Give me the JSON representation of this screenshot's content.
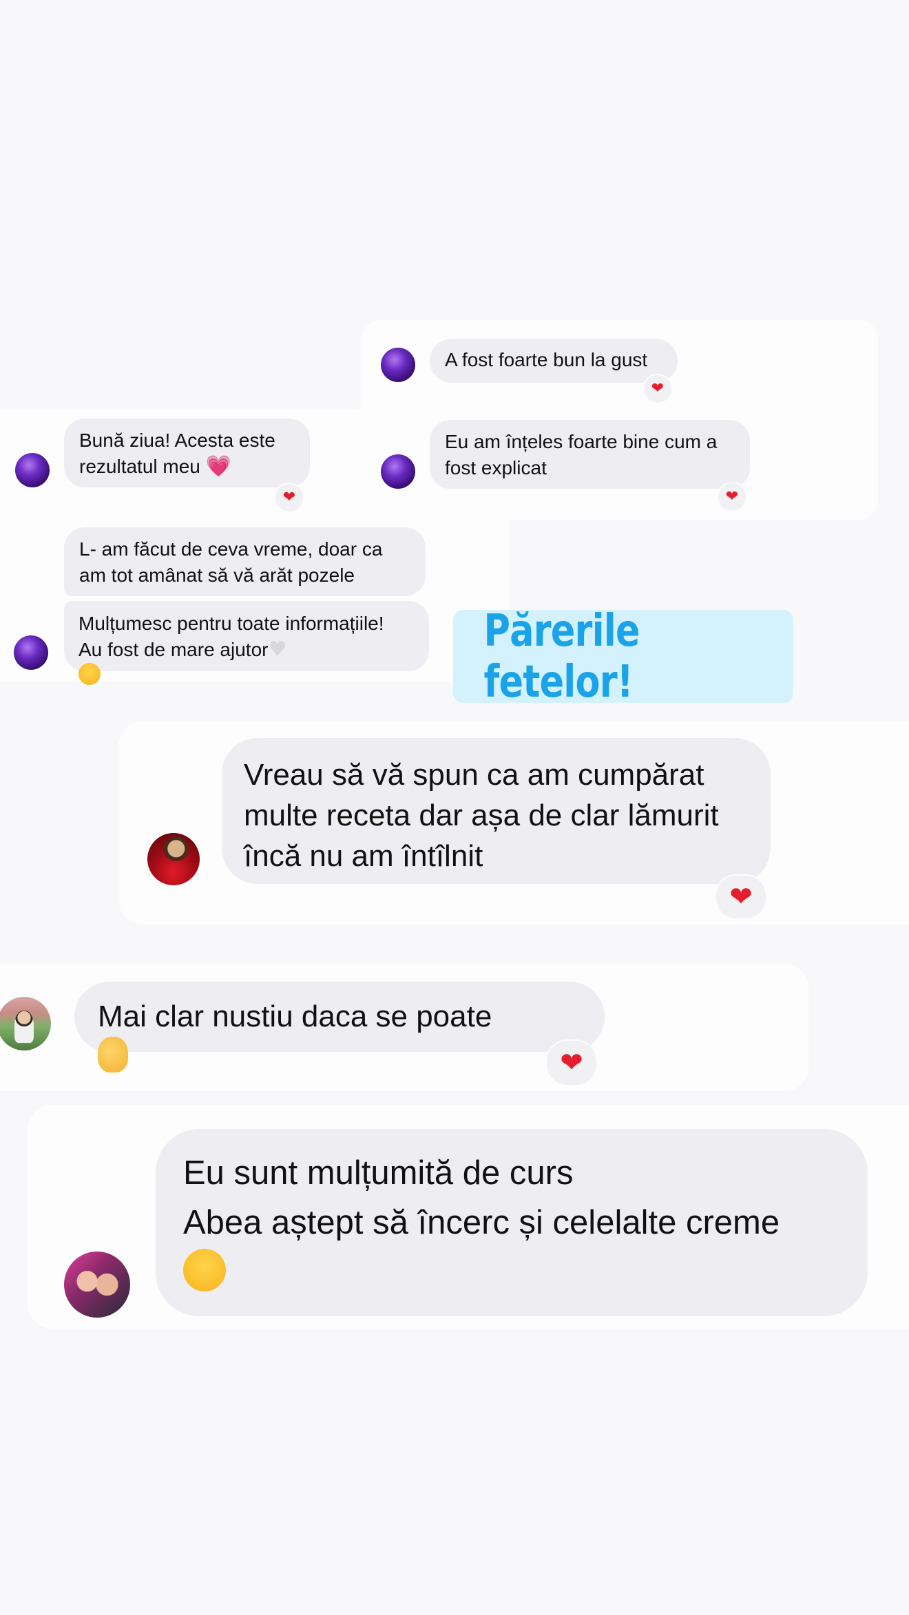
{
  "title": "Părerile fetelor!",
  "colors": {
    "background": "#f8f8fa",
    "bubble": "#eeeef2",
    "title_box": "#d3f2fd",
    "title_text": "#1aa3e8",
    "heart": "#e41e2c"
  },
  "screenshot_left": {
    "messages": [
      {
        "text": "Bună ziua! Acesta este\nrezultatul meu",
        "emoji": "pink-heart",
        "reaction": "❤"
      },
      {
        "text": "L- am făcut de ceva vreme, doar ca\nam tot amânat să vă arăt pozele"
      },
      {
        "text": "Mulțumesc pentru toate informațiile!\nAu fost de mare ajutor",
        "emoji": [
          "white-heart",
          "hugging-face"
        ]
      }
    ]
  },
  "screenshot_right": {
    "messages": [
      {
        "text": "A fost foarte bun la gust",
        "reaction": "❤"
      },
      {
        "text": "Eu am înțeles foarte bine cum a\nfost explicat",
        "reaction": "❤"
      }
    ]
  },
  "review_1": {
    "text": "Vreau să vă spun ca am cumpărat\nmulte receta dar așa de clar lămurit\nîncă nu am întîlnit",
    "reaction": "❤"
  },
  "review_2": {
    "text": "Mai clar nustiu daca se poate",
    "emoji": "ok-hand",
    "reaction": "❤"
  },
  "review_3": {
    "text": "Eu sunt mulțumită de curs\nAbea aștept să încerc și celelalte creme",
    "emoji": "hugging-face"
  }
}
